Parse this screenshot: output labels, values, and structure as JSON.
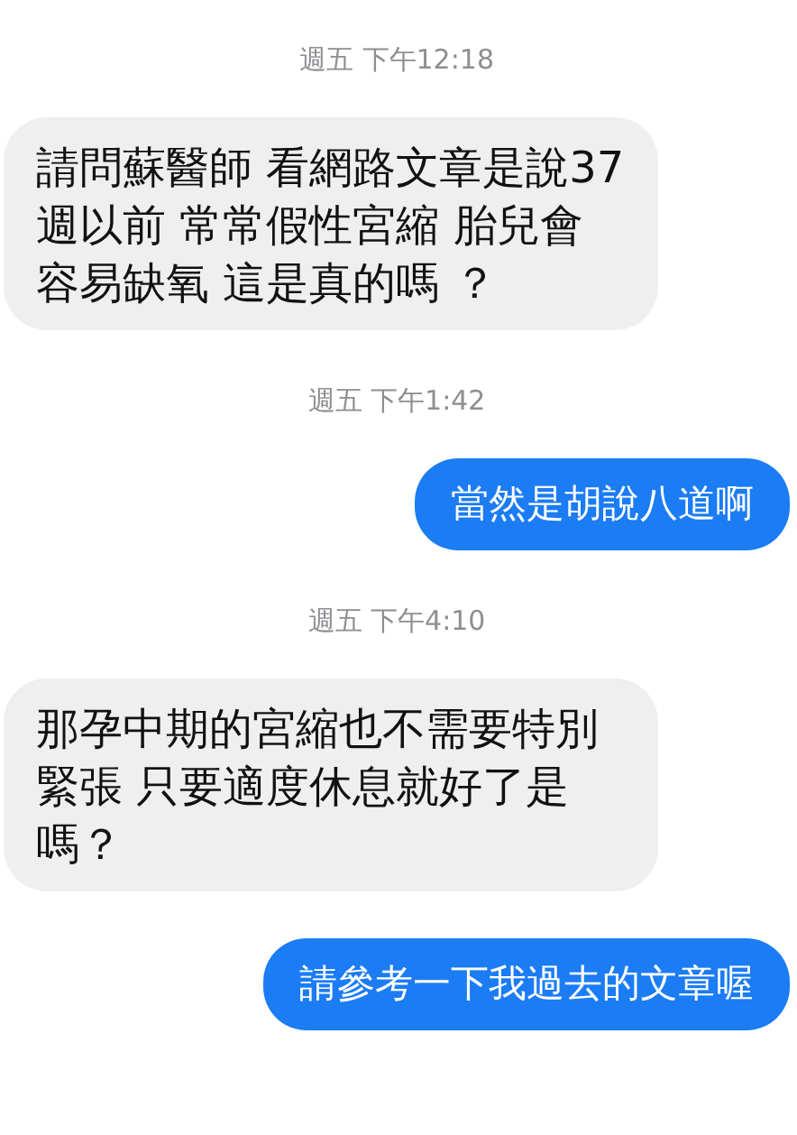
{
  "messages": [
    {
      "kind": "timestamp",
      "text": "週五 下午12:18"
    },
    {
      "kind": "incoming",
      "text": "請問蘇醫師 看網路文章是說37週以前 常常假性宮縮 胎兒會容易缺氧 這是真的嗎 ？"
    },
    {
      "kind": "timestamp",
      "text": "週五 下午1:42"
    },
    {
      "kind": "outgoing",
      "text": "當然是胡說八道啊"
    },
    {
      "kind": "timestamp",
      "text": "週五 下午4:10"
    },
    {
      "kind": "incoming",
      "text": "那孕中期的宮縮也不需要特別緊張 只要適度休息就好了是嗎？"
    },
    {
      "kind": "outgoing",
      "text": "請參考一下我過去的文章喔"
    }
  ]
}
